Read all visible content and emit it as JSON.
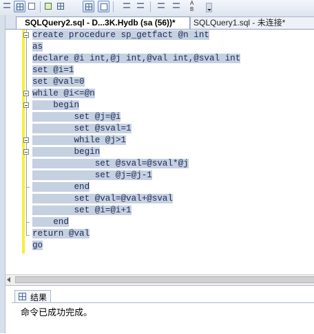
{
  "toolbar": {
    "icons": [
      "results-to-text-icon",
      "results-to-grid-icon",
      "results-to-file-icon",
      "display-plan-icon",
      "include-plan-icon",
      "client-stats-icon",
      "comment-icon",
      "uncomment-icon",
      "decrease-indent-icon",
      "increase-indent-icon",
      "specify-values-icon"
    ],
    "ab_label_top": "A",
    "ab_label_bottom": "B"
  },
  "tabs": [
    {
      "label": "SQLQuery2.sql - D...3K.Hydb (sa (56))*",
      "active": true
    },
    {
      "label": "SQLQuery1.sql - 未连接*",
      "active": false
    }
  ],
  "editor": {
    "lines": [
      "create procedure sp_getfact @n int",
      "as",
      "declare @i int,@j int,@val int,@sval int",
      "set @i=1",
      "set @val=0",
      "while @i<=@n",
      "    begin",
      "        set @j=@i",
      "        set @sval=1",
      "        while @j>1",
      "        begin",
      "            set @sval=@sval*@j",
      "            set @j=@j-1",
      "        end",
      "        set @val=@val+@sval",
      "        set @i=@i+1",
      "    end",
      "return @val",
      "go"
    ]
  },
  "results": {
    "tab_label": "结果",
    "message": "命令已成功完成。"
  }
}
